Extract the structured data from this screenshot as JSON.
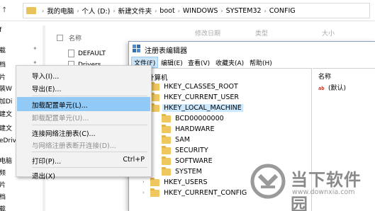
{
  "explorer": {
    "breadcrumbs": [
      "我的电脑",
      "个人 (D:)",
      "新建文件夹",
      "boot",
      "WINDOWS",
      "SYSTEM32",
      "CONFIG"
    ],
    "columns": {
      "name": "名称",
      "modified": "修改日期",
      "type": "类型",
      "size": "大小"
    },
    "nav_items": [
      "f",
      "载",
      "档",
      "片",
      "装W",
      "加Di",
      "建文",
      "建文",
      "eDriv",
      "电脑",
      "频",
      "片",
      "档",
      "载"
    ],
    "files": [
      "DEFAULT",
      "Drivers"
    ]
  },
  "regedit": {
    "title": "注册表编辑器",
    "menus": [
      "文件(F)",
      "编辑(E)",
      "查看(V)",
      "收藏夹(A)",
      "帮助(H)"
    ],
    "tree": {
      "root": "计算机",
      "nodes": [
        "HKEY_CLASSES_ROOT",
        "HKEY_CURRENT_USER",
        "HKEY_LOCAL_MACHINE",
        "BCD00000000",
        "HARDWARE",
        "SAM",
        "SECURITY",
        "SOFTWARE",
        "SYSTEM",
        "HKEY_USERS",
        "HKEY_CURRENT_CONFIG"
      ]
    },
    "values": {
      "header": "名称",
      "rows": [
        {
          "icon": "string-value-icon",
          "icon_text": "ab",
          "name": "(默认)"
        }
      ]
    }
  },
  "file_menu": {
    "items": [
      {
        "label": "导入(I)...",
        "state": "normal"
      },
      {
        "label": "导出(E)...",
        "state": "normal"
      },
      {
        "label": "加载配置单元(L)...",
        "state": "highlighted"
      },
      {
        "label": "卸载配置单元(U)...",
        "state": "disabled"
      },
      {
        "label": "连接网络注册表(C)...",
        "state": "normal"
      },
      {
        "label": "与网络注册表断开连接(D)...",
        "state": "disabled"
      },
      {
        "label": "打印(P)...",
        "state": "normal",
        "shortcut": "Ctrl+P"
      },
      {
        "label": "退出(X)",
        "state": "normal"
      }
    ]
  },
  "watermark": {
    "text": "当下软件园",
    "url": "www.downxia.com"
  }
}
